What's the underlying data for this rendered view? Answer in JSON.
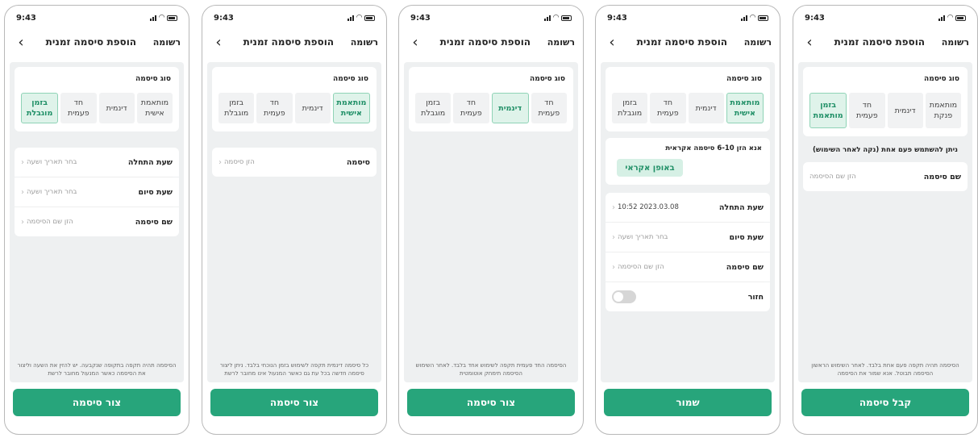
{
  "status": {
    "time": "9:43"
  },
  "nav": {
    "back": "<",
    "title": "הוספת סיסמה זמנית",
    "list": "רשומה"
  },
  "type_label": "סוג סיסמה",
  "types": {
    "timed": "בזמן מוגבלת",
    "one_time": "חד פעמית",
    "dynamic": "דינמית",
    "custom": "מותאמת אישית"
  },
  "screen1": {
    "types": [
      "מותאמת אישית",
      "דינמית",
      "חד פעמית",
      "בזמן מוגבלת"
    ],
    "rows": [
      {
        "label": "שעת התחלה",
        "value": "בחר תאריך ושעה"
      },
      {
        "label": "שעת סיום",
        "value": "בחר תאריך ושעה"
      },
      {
        "label": "שם סיסמה",
        "value": "הזן שם הסיסמה"
      }
    ],
    "footnote": "הסיסמה תהיה תקפה בתקופה שנקבעה. יש להזין את השעה וליצור את הסיסמה כאשר המנעול מחובר לרשת",
    "cta": "צור סיסמה"
  },
  "screen2": {
    "types": [
      "מותאמת אישית",
      "דינמית",
      "חד פעמית",
      "בזמן מוגבלת"
    ],
    "row": {
      "label": "סיסמה",
      "value": "הזן סיסמה"
    },
    "footnote": "כל סיסמה דינמית תקפה לשימוש בזמן הנוכחי בלבד. ניתן ליצור סיסמה חדשה בכל עת גם כאשר המנעול אינו מחובר לרשת",
    "cta": "צור סיסמה"
  },
  "screen3": {
    "types": [
      "חד פעמית",
      "דינמית",
      "חד פעמית",
      "בזמן מוגבלת"
    ],
    "footnote": "הסיסמה החד פעמית תקפה לשימוש אחד בלבד. לאחר השימוש הסיסמה תימחק אוטומטית",
    "cta": "צור סיסמה"
  },
  "screen4": {
    "types": [
      "מותאמת אישית",
      "דינמית",
      "חד פעמית",
      "בזמן מוגבלת"
    ],
    "random_hint": "אנא הזן 6-10 סיסמה אקראית",
    "random_btn": "באופן אקראי",
    "rows": [
      {
        "label": "שעת התחלה",
        "value": "2023.03.08 10:52"
      },
      {
        "label": "שעת סיום",
        "value": "בחר תאריך ושעה"
      },
      {
        "label": "שם סיסמה",
        "value": "הזן שם הסיסמה"
      }
    ],
    "repeat_label": "חזור",
    "cta": "שמור"
  },
  "screen5": {
    "types": [
      "מותאמת פנקת",
      "דינמית",
      "חד פעמית",
      "בזמן מותאמת"
    ],
    "once_note": "ניתן להשתמש פעם אחת (נקה לאחר השימוש)",
    "row": {
      "label": "שם סיסמה",
      "value": "הזן שם הסיסמה"
    },
    "footnote": "הסיסמה תהיה תקפה פעם אחת בלבד. לאחר השימוש הראשון הסיסמה תבוטל. אנא שמור את הסיסמה",
    "cta": "קבל סיסמה"
  },
  "colors": {
    "accent": "#27a57b",
    "selected_bg": "#dff3ea",
    "panel_bg": "#eef0f1"
  }
}
